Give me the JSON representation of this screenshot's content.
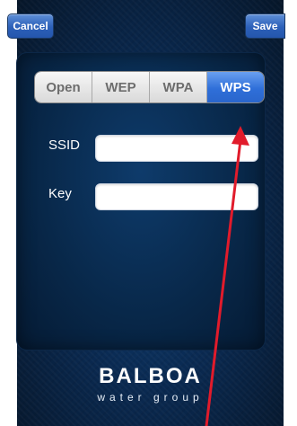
{
  "toolbar": {
    "cancel_label": "Cancel",
    "save_label": "Save"
  },
  "security_modes": {
    "options": [
      "Open",
      "WEP",
      "WPA",
      "WPS"
    ],
    "selected": "WPS"
  },
  "form": {
    "ssid_label": "SSID",
    "ssid_value": "",
    "key_label": "Key",
    "key_value": ""
  },
  "brand": {
    "name": "BALBOA",
    "tagline": "water group"
  },
  "colors": {
    "accent_blue": "#2f6fd9",
    "annotation_red": "#e11b2b"
  }
}
